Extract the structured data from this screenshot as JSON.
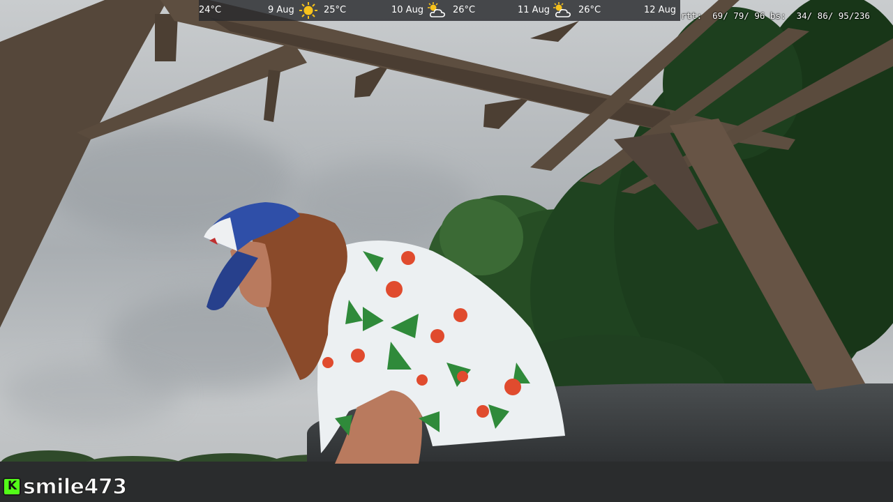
{
  "weather": {
    "items": [
      {
        "text": "24°C"
      },
      {
        "text": "9 Aug"
      },
      {
        "icon": "sun-icon"
      },
      {
        "text": "25°C"
      },
      {
        "text": "10 Aug"
      },
      {
        "icon": "partly-cloudy-icon"
      },
      {
        "text": "26°C"
      },
      {
        "text": "11 Aug"
      },
      {
        "icon": "partly-cloudy-icon"
      },
      {
        "text": "26°C"
      },
      {
        "text": "12 Aug"
      }
    ]
  },
  "stats": {
    "text": "rtt:  69/ 79/ 96 bs:  34/ 86/ 95/236"
  },
  "watermark": {
    "logo_letter": "K",
    "channel": "smile473"
  },
  "colors": {
    "kick_green": "#53fc18",
    "sun_yellow": "#f7c21c",
    "bar_bg": "#2a2c2f"
  }
}
